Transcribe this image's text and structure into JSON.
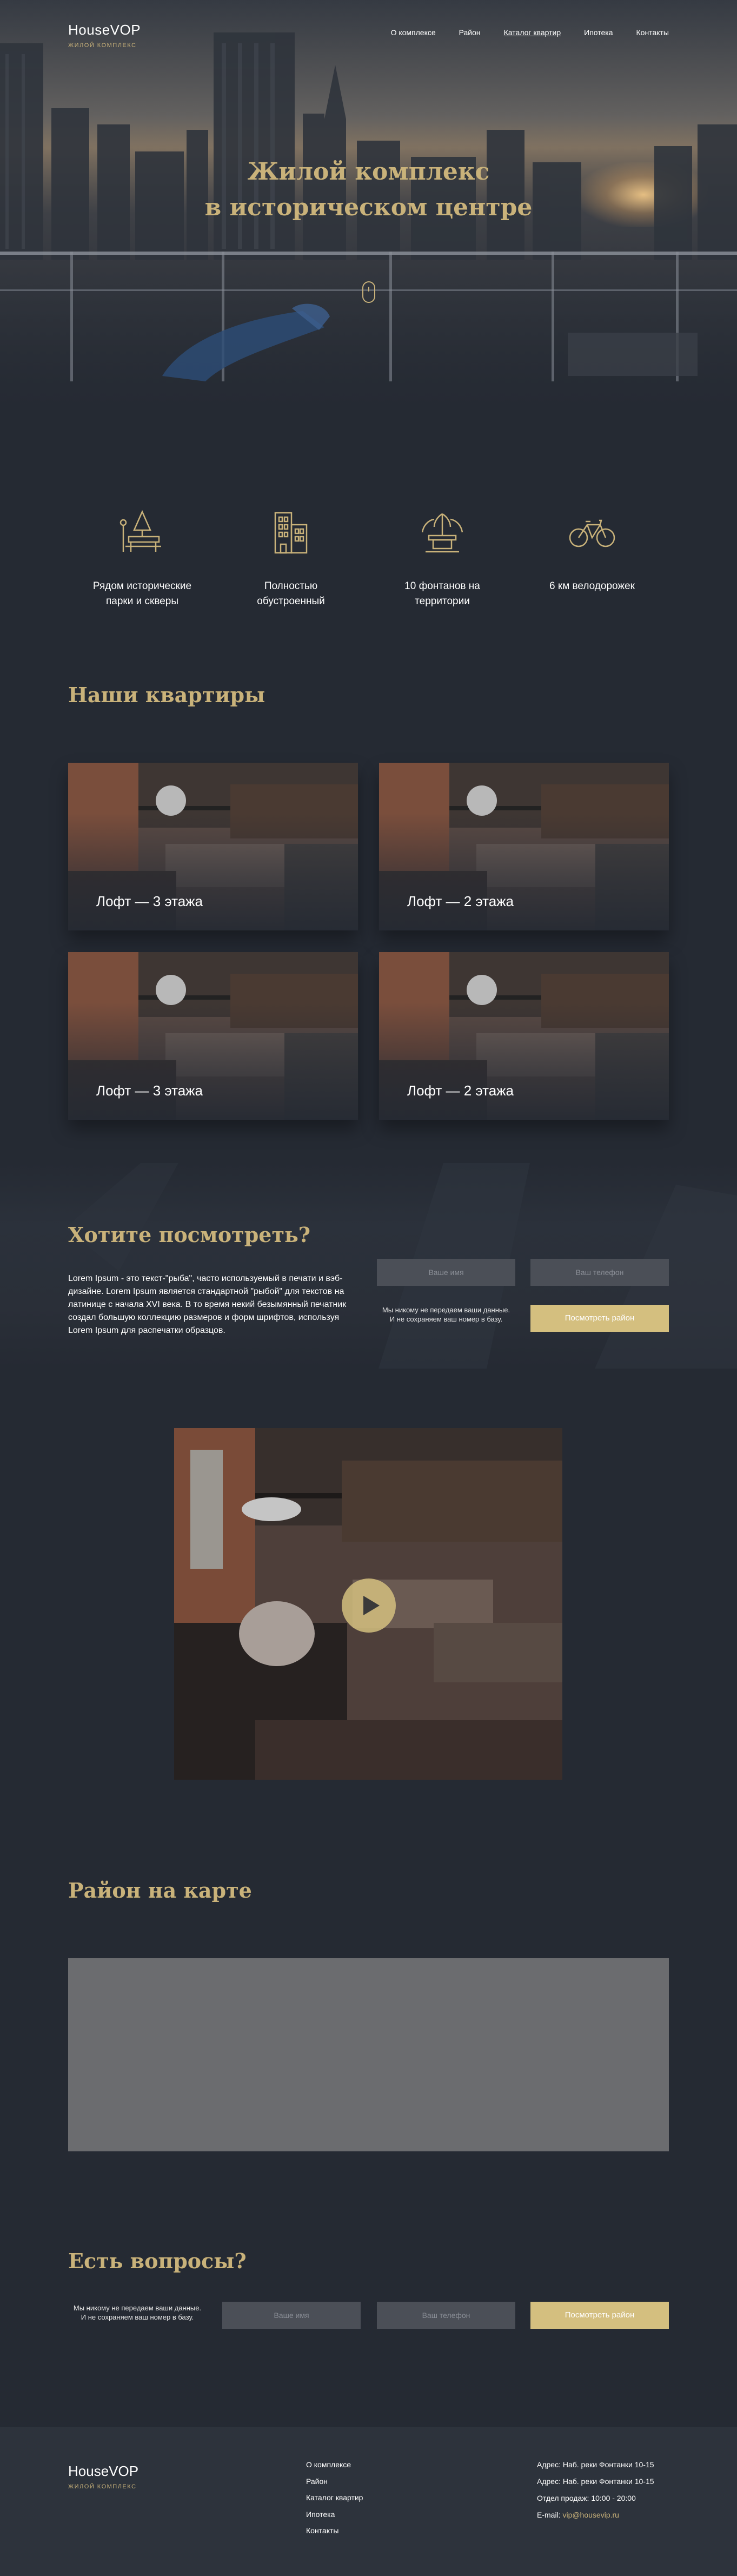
{
  "header": {
    "logo": "HouseVOP",
    "logo_sub": "ЖИЛОЙ КОМПЛЕКС",
    "nav": [
      "О комплексе",
      "Район",
      "Каталог квартир",
      "Ипотека",
      "Контакты"
    ],
    "active_nav": "Каталог квартир"
  },
  "hero": {
    "title_line1": "Жилой комплекс",
    "title_line2": "в историческом центре"
  },
  "features": [
    {
      "icon": "park-bench-icon",
      "text_line1": "Рядом исторические",
      "text_line2": "парки и скверы"
    },
    {
      "icon": "building-icon",
      "text_line1": "Полностью",
      "text_line2": "обустроенный"
    },
    {
      "icon": "fountain-icon",
      "text_line1": "10 фонтанов на",
      "text_line2": "территории"
    },
    {
      "icon": "bicycle-icon",
      "text_line1": "6 км велодорожек",
      "text_line2": ""
    }
  ],
  "apartments": {
    "title": "Наши квартиры",
    "items": [
      {
        "label": "Лофт — 3 этажа"
      },
      {
        "label": "Лофт — 2 этажа"
      },
      {
        "label": "Лофт — 3 этажа"
      },
      {
        "label": "Лофт — 2 этажа"
      }
    ]
  },
  "viewing": {
    "title": "Хотите посмотреть?",
    "text": "Lorem Ipsum - это текст-\"рыба\", часто используемый в печати и вэб-дизайне. Lorem Ipsum является стандартной \"рыбой\" для текстов на латинице с начала XVI века. В то время некий безымянный печатник создал большую коллекцию размеров и форм шрифтов, используя Lorem Ipsum для распечатки образцов.",
    "name_placeholder": "Ваше имя",
    "phone_placeholder": "Ваш телефон",
    "note_line1": "Мы никому не передаем ваши данные.",
    "note_line2": "И не сохраняем ваш номер в базу.",
    "button": "Посмотреть район"
  },
  "map": {
    "title": "Район на карте"
  },
  "questions": {
    "title": "Есть вопросы?",
    "note_line1": "Мы никому не передаем ваши данные.",
    "note_line2": "И не сохраняем ваш номер в базу.",
    "name_placeholder": "Ваше имя",
    "phone_placeholder": "Ваш телефон",
    "button": "Посмотреть район"
  },
  "footer": {
    "logo": "HouseVOP",
    "logo_sub": "ЖИЛОЙ КОМПЛЕКС",
    "nav": [
      "О комплексе",
      "Район",
      "Каталог квартир",
      "Ипотека",
      "Контакты"
    ],
    "address1": "Адрес: Наб. реки Фонтанки 10-15",
    "address2": "Адрес: Наб. реки Фонтанки 10-15",
    "hours": "Отдел продаж: 10:00 - 20:00",
    "email_label": "E-mail: ",
    "email": "vip@housevip.ru"
  },
  "colors": {
    "background": "#252a33",
    "accent_gold": "#c9b27a",
    "button_gold": "#d4bf7f",
    "input_gray": "#4b4f57",
    "map_gray": "#6b6c6f",
    "footer_bg": "#2d333c"
  }
}
